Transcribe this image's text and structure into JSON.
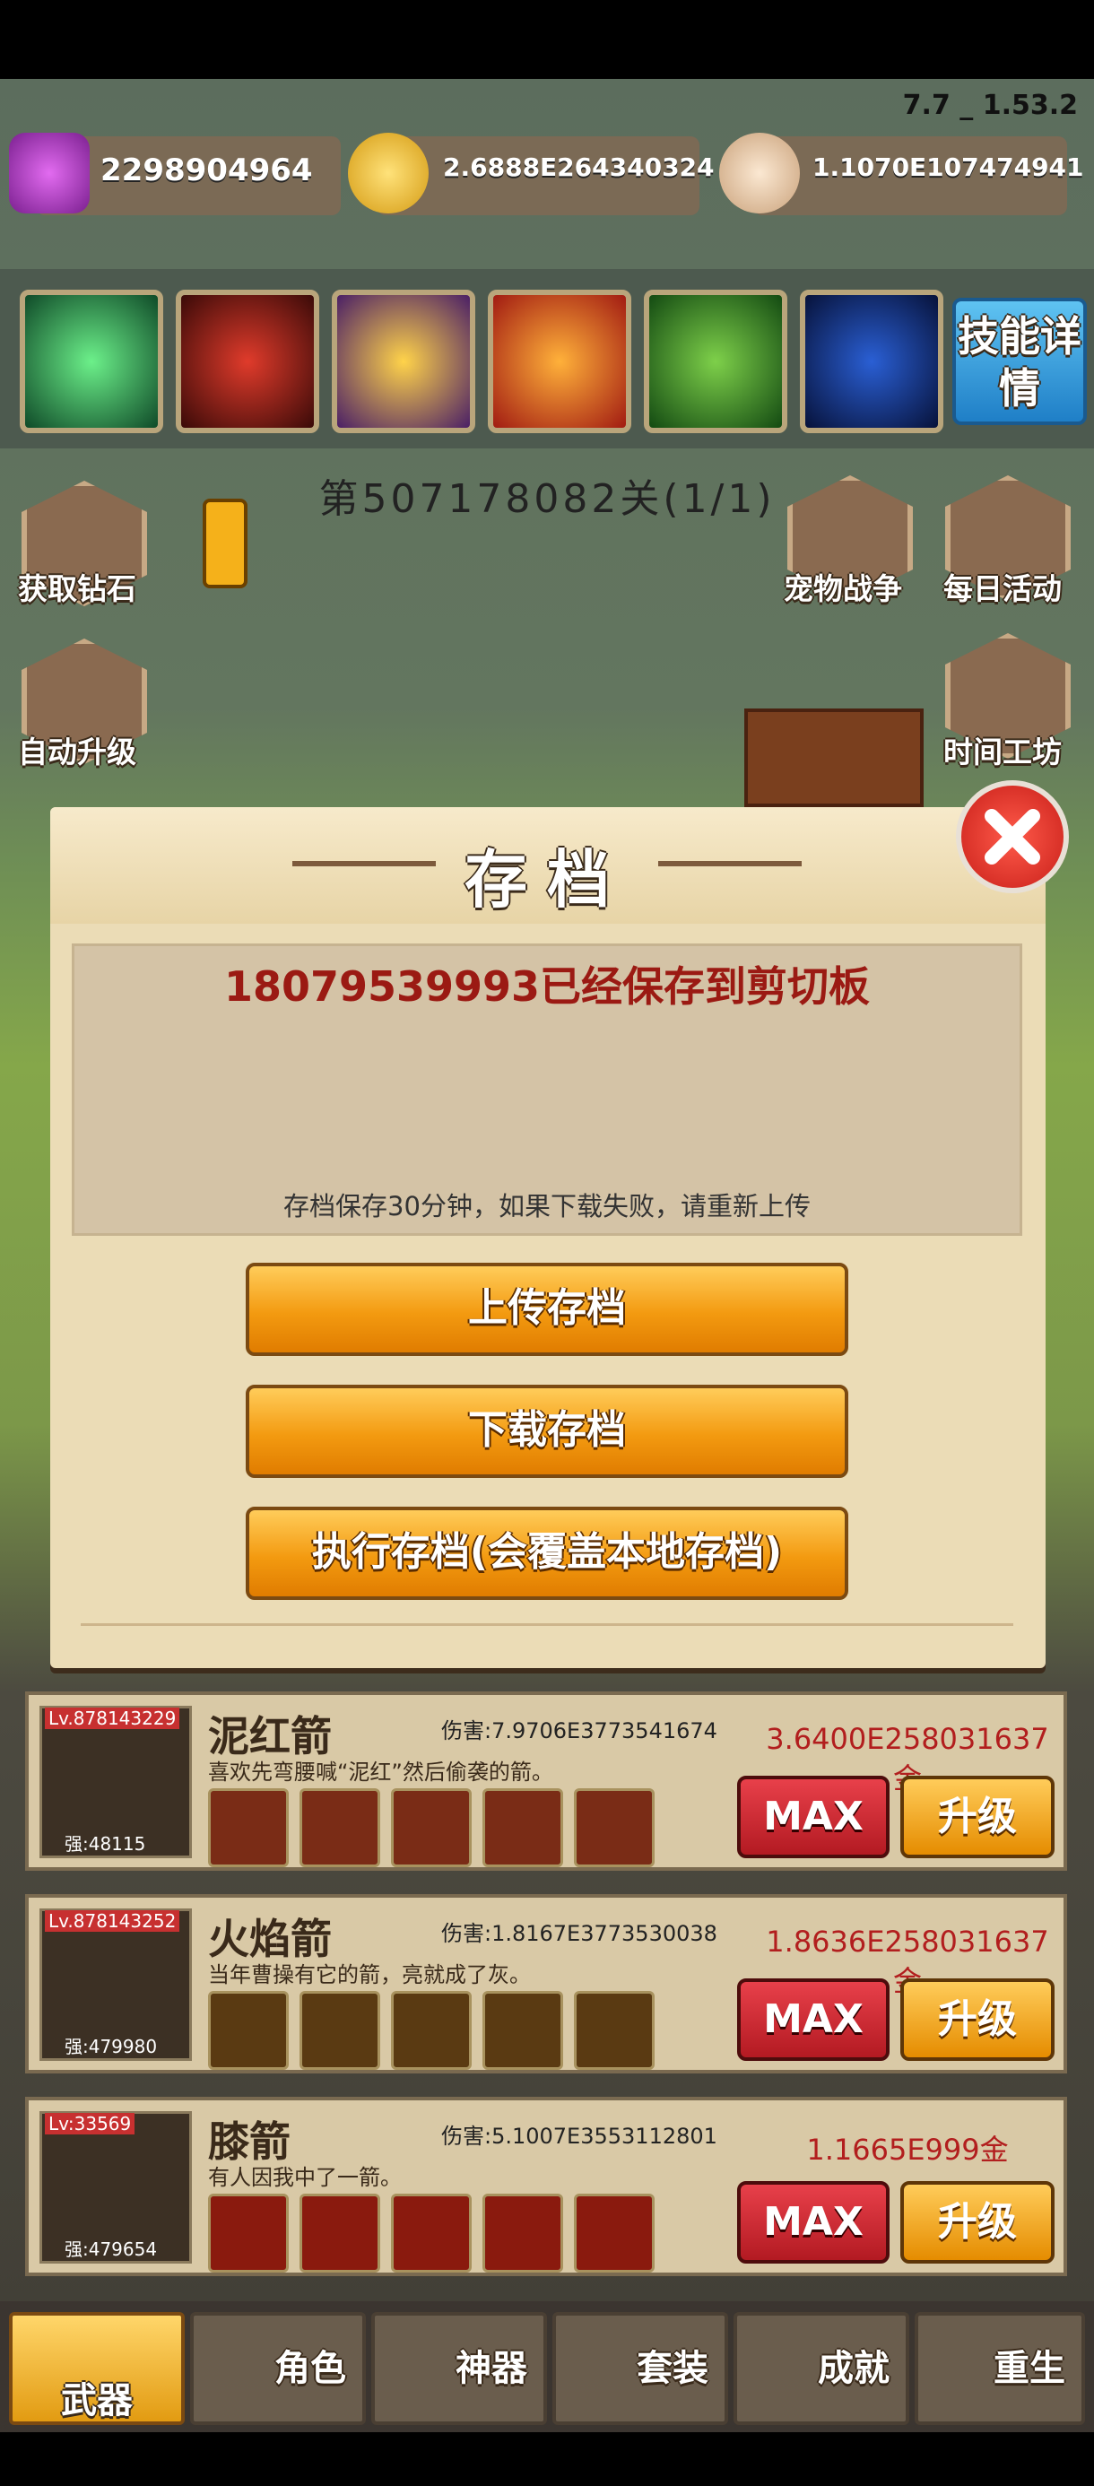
{
  "version": "7.7 _ 1.53.2",
  "resources": {
    "gems": "2298904964",
    "gold": "2.6888E264340324",
    "skulls": "1.1070E107474941"
  },
  "skills": {
    "detail_label": "技能详情"
  },
  "stage": "第507178082关(1/1)",
  "side_buttons": {
    "get_gems": "获取钻石",
    "auto_upgrade": "自动升级",
    "pet_battle": "宠物战争",
    "daily_event": "每日活动",
    "time_workshop": "时间工坊"
  },
  "dialog": {
    "title": "存档",
    "message": "18079539993已经保存到剪切板",
    "note": "存档保存30分钟，如果下载失败，请重新上传",
    "upload": "上传存档",
    "download": "下载存档",
    "execute": "执行存档(会覆盖本地存档)"
  },
  "weapons": [
    {
      "level": "Lv.878143229",
      "count": "强:48115",
      "name": "泥红箭",
      "damage": "伤害:7.9706E3773541674",
      "desc": "喜欢先弯腰喊“泥红”然后偷袭的箭。",
      "cost": "3.6400E258031637金",
      "max": "MAX",
      "upgrade": "升级"
    },
    {
      "level": "Lv.878143252",
      "count": "强:479980",
      "name": "火焰箭",
      "damage": "伤害:1.8167E3773530038",
      "desc": "当年曹操有它的箭，亮就成了灰。",
      "cost": "1.8636E258031637金",
      "max": "MAX",
      "upgrade": "升级"
    },
    {
      "level": "Lv:33569",
      "count": "强:479654",
      "name": "膝箭",
      "damage": "伤害:5.1007E3553112801",
      "desc": "有人因我中了一箭。",
      "cost": "1.1665E999金",
      "max": "MAX",
      "upgrade": "升级"
    }
  ],
  "nav": {
    "weapon": "武器",
    "role": "角色",
    "artifact": "神器",
    "outfit": "套装",
    "achievement": "成就",
    "rebirth": "重生"
  }
}
